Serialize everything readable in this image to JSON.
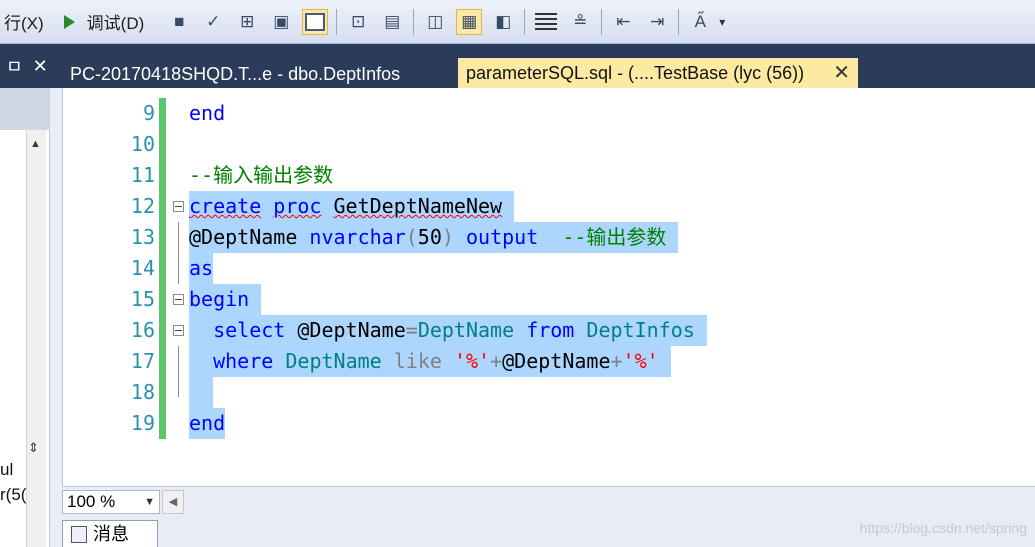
{
  "toolbar": {
    "execute_label": "行(X)",
    "debug_label": "调试(D)"
  },
  "left_panel": {
    "pin_glyph": "ㅁ",
    "close_glyph": "✕",
    "partial_text_1": "ul",
    "partial_text_2": "r(5("
  },
  "tabs": [
    {
      "label": "PC-20170418SHQD.T...e - dbo.DeptInfos",
      "active": false
    },
    {
      "label": "parameterSQL.sql - (....TestBase (lyc (56))",
      "active": true
    }
  ],
  "editor": {
    "lines": [
      {
        "num": "9",
        "text": "end"
      },
      {
        "num": "10",
        "text": ""
      },
      {
        "num": "11",
        "text": "--输入输出参数"
      },
      {
        "num": "12",
        "text": "create proc GetDeptNameNew"
      },
      {
        "num": "13",
        "text": "@DeptName nvarchar(50) output  --输出参数"
      },
      {
        "num": "14",
        "text": "as"
      },
      {
        "num": "15",
        "text": "begin"
      },
      {
        "num": "16",
        "text": "  select @DeptName=DeptName from DeptInfos"
      },
      {
        "num": "17",
        "text": "  where DeptName like '%'+@DeptName+'%'"
      },
      {
        "num": "18",
        "text": ""
      },
      {
        "num": "19",
        "text": "end"
      }
    ]
  },
  "status": {
    "zoom": "100 %"
  },
  "bottom": {
    "messages_tab": "消息",
    "watermark": "https://blog.csdn.net/spring"
  }
}
